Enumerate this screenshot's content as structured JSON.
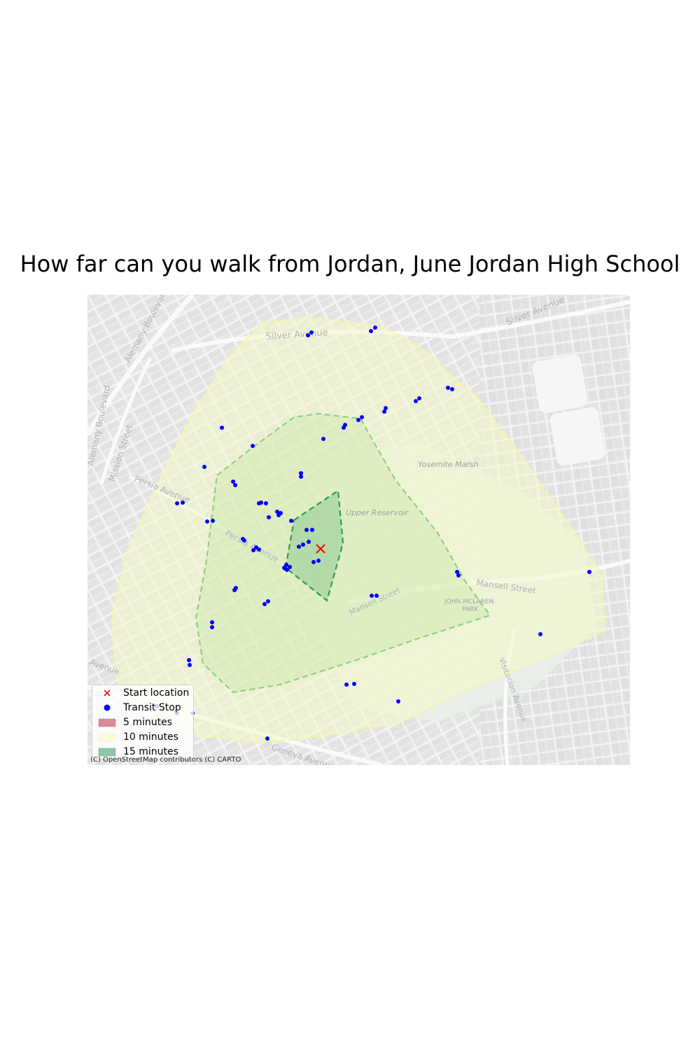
{
  "title": "How far can you walk from Jordan, June Jordan High School",
  "attribution": "(C) OpenStreetMap contributors (C) CARTO",
  "legend": {
    "items": [
      {
        "label": "Start location",
        "symbol": "red-x-marker",
        "color": "#ff0000"
      },
      {
        "label": "Transit Stop",
        "symbol": "blue-dot-marker",
        "color": "#0000ff"
      },
      {
        "label": "5 minutes",
        "symbol": "patch",
        "color": "#d98a99"
      },
      {
        "label": "10 minutes",
        "symbol": "patch",
        "color": "#fbfbd4"
      },
      {
        "label": "15 minutes",
        "symbol": "patch",
        "color": "#8fc4a8"
      }
    ]
  },
  "map_labels": {
    "silver_avenue_top": "Silver Avenue",
    "silver_avenue_right": "Silver Avenue",
    "alemany_boulevard_top": "Alemany Boulevard",
    "alemany_boulevard_left": "Alemany Boulevard",
    "mission_street": "Mission Street",
    "persia_avenue": "Persia Avenue",
    "persia_avenue_2": "Persia Avenue",
    "yosemite_marsh": "Yosemite Marsh",
    "upper_reservoir": "Upper Reservoir",
    "mansell_street": "Mansell Street",
    "mansell_street_2": "Mansell Street",
    "john_mclaren_park_1": "JOHN MCLAREN",
    "john_mclaren_park_2": "PARK",
    "visitacion_avenue": "Visitacion Avenue",
    "geneva_avenue": "Geneva Avenue",
    "avenue_left": "Avenue"
  },
  "colors": {
    "isochrone_outer_fill": "#f4f8c8",
    "isochrone_outer_edge": "#f2f7a0",
    "isochrone_mid_fill": "#cbe8a8",
    "isochrone_mid_edge": "#8fd07e",
    "isochrone_inner_fill": "#7ec48c",
    "isochrone_inner_edge": "#2e9a4c",
    "start_marker": "#ff0000",
    "transit_stop": "#0000ff"
  },
  "start_location": {
    "label": "Start location"
  },
  "transit_stop_count": 74
}
